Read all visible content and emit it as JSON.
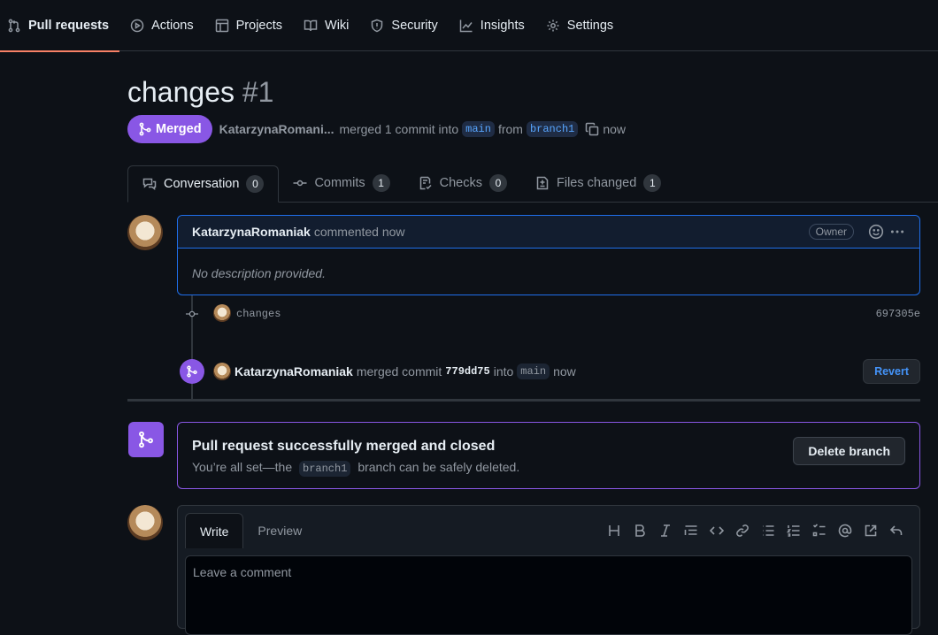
{
  "nav": {
    "items": [
      {
        "label": "Pull requests",
        "icon": "git-pull-request-icon",
        "active": true
      },
      {
        "label": "Actions",
        "icon": "play-icon"
      },
      {
        "label": "Projects",
        "icon": "table-icon"
      },
      {
        "label": "Wiki",
        "icon": "book-icon"
      },
      {
        "label": "Security",
        "icon": "shield-icon"
      },
      {
        "label": "Insights",
        "icon": "graph-icon"
      },
      {
        "label": "Settings",
        "icon": "gear-icon"
      }
    ]
  },
  "pr": {
    "title": "changes",
    "number": "#1",
    "state": "Merged",
    "author_short": "KatarzynaRomani...",
    "summary_pre": "merged 1 commit into",
    "base": "main",
    "from_word": "from",
    "head": "branch1",
    "time": "now"
  },
  "tabs": [
    {
      "label": "Conversation",
      "count": "0",
      "icon": "comment-discussion-icon",
      "active": true
    },
    {
      "label": "Commits",
      "count": "1",
      "icon": "git-commit-icon"
    },
    {
      "label": "Checks",
      "count": "0",
      "icon": "checklist-icon"
    },
    {
      "label": "Files changed",
      "count": "1",
      "icon": "file-diff-icon"
    }
  ],
  "comment": {
    "author": "KatarzynaRomaniak",
    "action": "commented now",
    "role": "Owner",
    "body": "No description provided."
  },
  "commit": {
    "message": "changes",
    "sha": "697305e"
  },
  "merge_event": {
    "author": "KatarzynaRomaniak",
    "text": "merged commit",
    "sha": "779dd75",
    "into": "into",
    "branch": "main",
    "time": "now",
    "revert_label": "Revert"
  },
  "merge_box": {
    "heading": "Pull request successfully merged and closed",
    "sub_pre": "You’re all set—the",
    "branch": "branch1",
    "sub_post": "branch can be safely deleted.",
    "delete_label": "Delete branch"
  },
  "editor": {
    "tab_write": "Write",
    "tab_preview": "Preview",
    "placeholder": "Leave a comment"
  },
  "colors": {
    "merged": "#8957e5",
    "accent_underline": "#f78166",
    "link": "#4493f8"
  }
}
